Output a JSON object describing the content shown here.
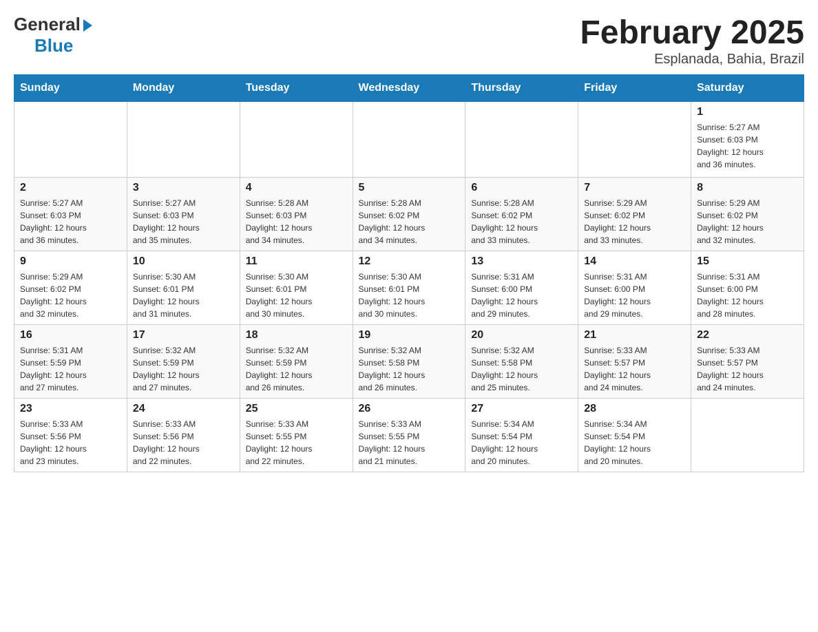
{
  "header": {
    "logo_general": "General",
    "logo_blue": "Blue",
    "title": "February 2025",
    "subtitle": "Esplanada, Bahia, Brazil"
  },
  "weekdays": [
    "Sunday",
    "Monday",
    "Tuesday",
    "Wednesday",
    "Thursday",
    "Friday",
    "Saturday"
  ],
  "weeks": [
    {
      "days": [
        {
          "number": "",
          "info": ""
        },
        {
          "number": "",
          "info": ""
        },
        {
          "number": "",
          "info": ""
        },
        {
          "number": "",
          "info": ""
        },
        {
          "number": "",
          "info": ""
        },
        {
          "number": "",
          "info": ""
        },
        {
          "number": "1",
          "info": "Sunrise: 5:27 AM\nSunset: 6:03 PM\nDaylight: 12 hours\nand 36 minutes."
        }
      ]
    },
    {
      "days": [
        {
          "number": "2",
          "info": "Sunrise: 5:27 AM\nSunset: 6:03 PM\nDaylight: 12 hours\nand 36 minutes."
        },
        {
          "number": "3",
          "info": "Sunrise: 5:27 AM\nSunset: 6:03 PM\nDaylight: 12 hours\nand 35 minutes."
        },
        {
          "number": "4",
          "info": "Sunrise: 5:28 AM\nSunset: 6:03 PM\nDaylight: 12 hours\nand 34 minutes."
        },
        {
          "number": "5",
          "info": "Sunrise: 5:28 AM\nSunset: 6:02 PM\nDaylight: 12 hours\nand 34 minutes."
        },
        {
          "number": "6",
          "info": "Sunrise: 5:28 AM\nSunset: 6:02 PM\nDaylight: 12 hours\nand 33 minutes."
        },
        {
          "number": "7",
          "info": "Sunrise: 5:29 AM\nSunset: 6:02 PM\nDaylight: 12 hours\nand 33 minutes."
        },
        {
          "number": "8",
          "info": "Sunrise: 5:29 AM\nSunset: 6:02 PM\nDaylight: 12 hours\nand 32 minutes."
        }
      ]
    },
    {
      "days": [
        {
          "number": "9",
          "info": "Sunrise: 5:29 AM\nSunset: 6:02 PM\nDaylight: 12 hours\nand 32 minutes."
        },
        {
          "number": "10",
          "info": "Sunrise: 5:30 AM\nSunset: 6:01 PM\nDaylight: 12 hours\nand 31 minutes."
        },
        {
          "number": "11",
          "info": "Sunrise: 5:30 AM\nSunset: 6:01 PM\nDaylight: 12 hours\nand 30 minutes."
        },
        {
          "number": "12",
          "info": "Sunrise: 5:30 AM\nSunset: 6:01 PM\nDaylight: 12 hours\nand 30 minutes."
        },
        {
          "number": "13",
          "info": "Sunrise: 5:31 AM\nSunset: 6:00 PM\nDaylight: 12 hours\nand 29 minutes."
        },
        {
          "number": "14",
          "info": "Sunrise: 5:31 AM\nSunset: 6:00 PM\nDaylight: 12 hours\nand 29 minutes."
        },
        {
          "number": "15",
          "info": "Sunrise: 5:31 AM\nSunset: 6:00 PM\nDaylight: 12 hours\nand 28 minutes."
        }
      ]
    },
    {
      "days": [
        {
          "number": "16",
          "info": "Sunrise: 5:31 AM\nSunset: 5:59 PM\nDaylight: 12 hours\nand 27 minutes."
        },
        {
          "number": "17",
          "info": "Sunrise: 5:32 AM\nSunset: 5:59 PM\nDaylight: 12 hours\nand 27 minutes."
        },
        {
          "number": "18",
          "info": "Sunrise: 5:32 AM\nSunset: 5:59 PM\nDaylight: 12 hours\nand 26 minutes."
        },
        {
          "number": "19",
          "info": "Sunrise: 5:32 AM\nSunset: 5:58 PM\nDaylight: 12 hours\nand 26 minutes."
        },
        {
          "number": "20",
          "info": "Sunrise: 5:32 AM\nSunset: 5:58 PM\nDaylight: 12 hours\nand 25 minutes."
        },
        {
          "number": "21",
          "info": "Sunrise: 5:33 AM\nSunset: 5:57 PM\nDaylight: 12 hours\nand 24 minutes."
        },
        {
          "number": "22",
          "info": "Sunrise: 5:33 AM\nSunset: 5:57 PM\nDaylight: 12 hours\nand 24 minutes."
        }
      ]
    },
    {
      "days": [
        {
          "number": "23",
          "info": "Sunrise: 5:33 AM\nSunset: 5:56 PM\nDaylight: 12 hours\nand 23 minutes."
        },
        {
          "number": "24",
          "info": "Sunrise: 5:33 AM\nSunset: 5:56 PM\nDaylight: 12 hours\nand 22 minutes."
        },
        {
          "number": "25",
          "info": "Sunrise: 5:33 AM\nSunset: 5:55 PM\nDaylight: 12 hours\nand 22 minutes."
        },
        {
          "number": "26",
          "info": "Sunrise: 5:33 AM\nSunset: 5:55 PM\nDaylight: 12 hours\nand 21 minutes."
        },
        {
          "number": "27",
          "info": "Sunrise: 5:34 AM\nSunset: 5:54 PM\nDaylight: 12 hours\nand 20 minutes."
        },
        {
          "number": "28",
          "info": "Sunrise: 5:34 AM\nSunset: 5:54 PM\nDaylight: 12 hours\nand 20 minutes."
        },
        {
          "number": "",
          "info": ""
        }
      ]
    }
  ]
}
